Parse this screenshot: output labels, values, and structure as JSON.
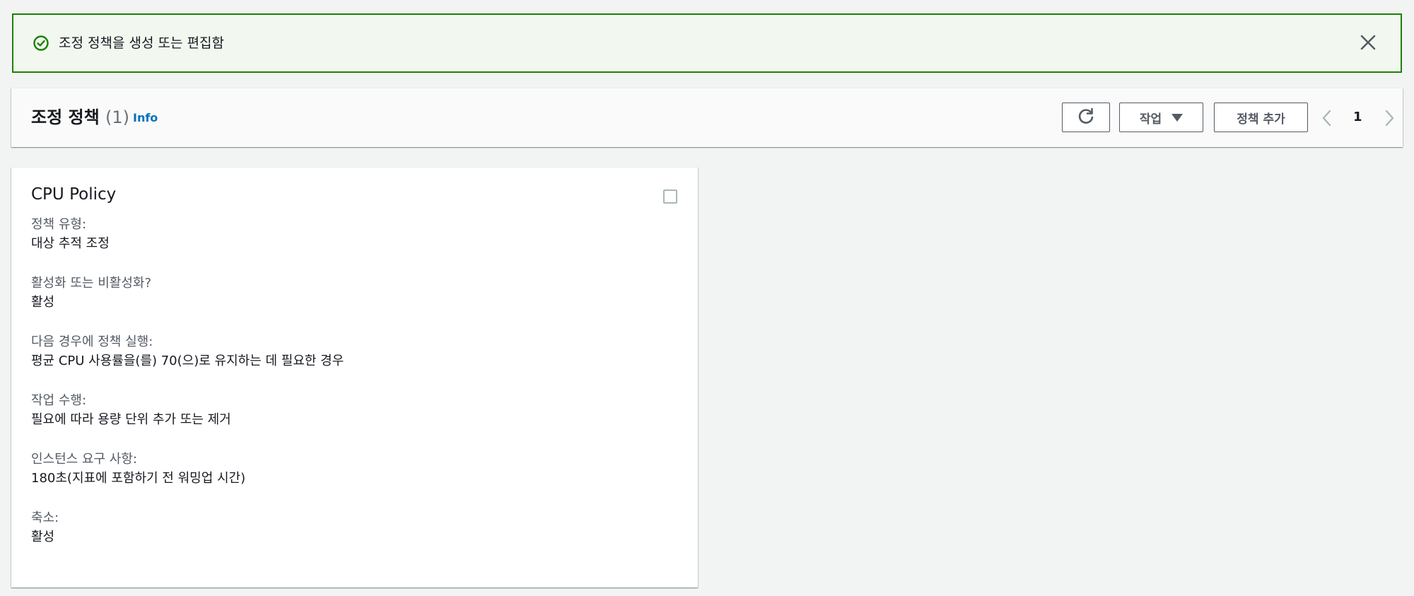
{
  "flash": {
    "type": "success",
    "message": "조정 정책을 생성 또는 편집함",
    "icon": "status-success-icon",
    "close_icon": "close-icon",
    "color": "#1d8102"
  },
  "header": {
    "title": "조정 정책",
    "count": "(1)",
    "info_link": "Info",
    "refresh_icon": "refresh-icon",
    "actions_label": "작업",
    "add_label": "정책 추가",
    "page_number": "1"
  },
  "policy": {
    "name": "CPU Policy",
    "fields": [
      {
        "label": "정책 유형:",
        "value": "대상 추적 조정"
      },
      {
        "label": "활성화 또는 비활성화?",
        "value": "활성"
      },
      {
        "label": "다음 경우에 정책 실행:",
        "value": "평균 CPU 사용률을(를) 70(으)로 유지하는 데 필요한 경우"
      },
      {
        "label": "작업 수행:",
        "value": "필요에 따라 용량 단위 추가 또는 제거"
      },
      {
        "label": "인스턴스 요구 사항:",
        "value": "180초(지표에 포함하기 전 워밍업 시간)"
      },
      {
        "label": "축소:",
        "value": "활성"
      }
    ]
  },
  "colors": {
    "accent": "#0073bb",
    "success": "#1d8102",
    "text": "#16191f",
    "muted": "#545b64"
  }
}
